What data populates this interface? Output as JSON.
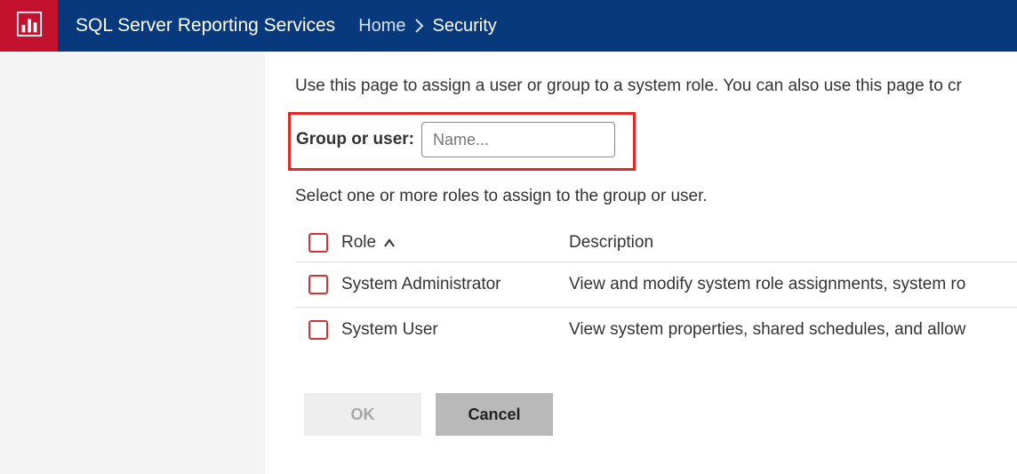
{
  "header": {
    "app_title": "SQL Server Reporting Services",
    "breadcrumb": {
      "home": "Home",
      "current": "Security"
    }
  },
  "main": {
    "intro": "Use this page to assign a user or group to a system role. You can also use this page to cr",
    "group_user_label": "Group or user:",
    "name_placeholder": "Name...",
    "select_text": "Select one or more roles to assign to the group or user.",
    "table": {
      "header": {
        "role": "Role",
        "description": "Description"
      },
      "rows": [
        {
          "role": "System Administrator",
          "description": "View and modify system role assignments, system ro"
        },
        {
          "role": "System User",
          "description": "View system properties, shared schedules, and allow"
        }
      ]
    },
    "buttons": {
      "ok": "OK",
      "cancel": "Cancel"
    }
  },
  "colors": {
    "header_bg": "#08397c",
    "logo_bg": "#c4122e",
    "highlight_border": "#e02b27",
    "checkbox_border": "#d13438"
  }
}
